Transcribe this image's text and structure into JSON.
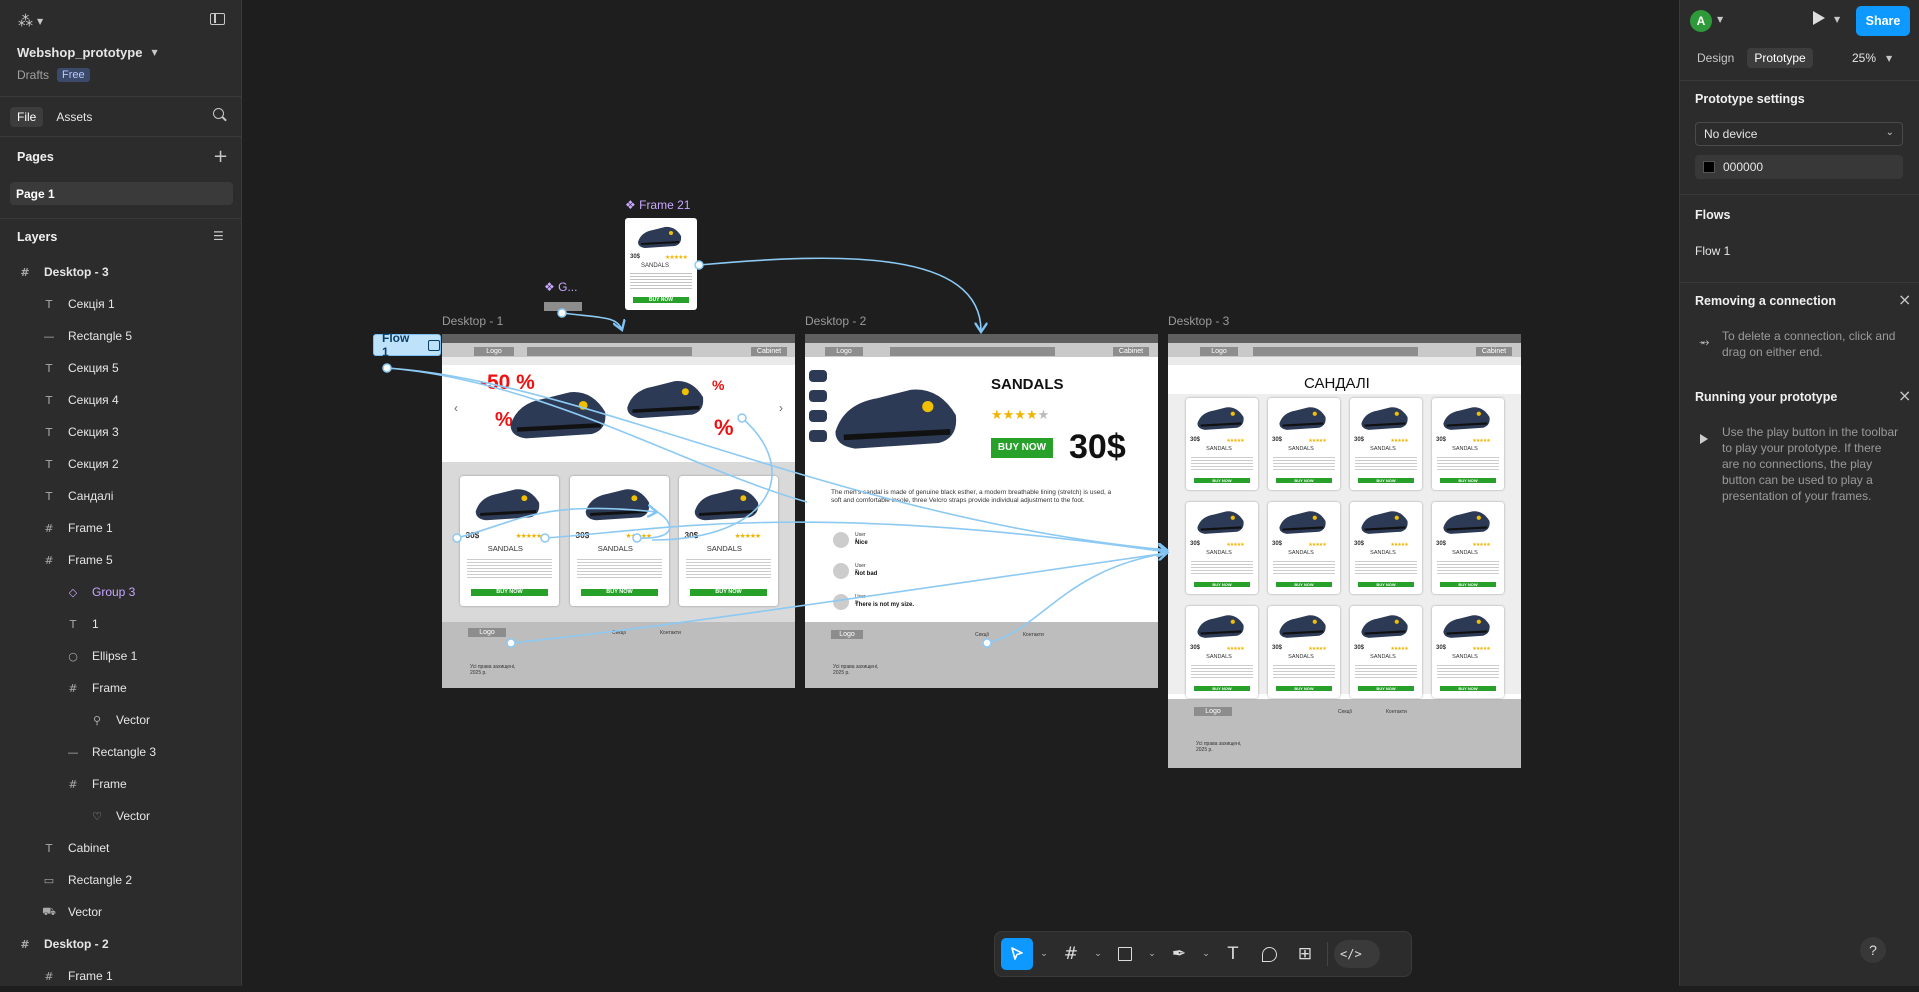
{
  "file": {
    "name": "Webshop_prototype",
    "location": "Drafts",
    "plan": "Free"
  },
  "left_tabs": {
    "file": "File",
    "assets": "Assets"
  },
  "pages": {
    "title": "Pages",
    "items": [
      "Page 1"
    ]
  },
  "layers": {
    "title": "Layers",
    "items": [
      {
        "icon": "frame-icon",
        "glyph": "#",
        "label": "Desktop - 3",
        "bold": true
      },
      {
        "icon": "text-icon",
        "glyph": "T",
        "label": "Секція 1"
      },
      {
        "icon": "rectangle-icon",
        "glyph": "—",
        "label": "Rectangle 5"
      },
      {
        "icon": "text-icon",
        "glyph": "T",
        "label": "Секция 5"
      },
      {
        "icon": "text-icon",
        "glyph": "T",
        "label": "Секция 4"
      },
      {
        "icon": "text-icon",
        "glyph": "T",
        "label": "Секция 3"
      },
      {
        "icon": "text-icon",
        "glyph": "T",
        "label": "Секция 2"
      },
      {
        "icon": "text-icon",
        "glyph": "T",
        "label": "Сандалі"
      },
      {
        "icon": "frame-icon",
        "glyph": "#",
        "label": "Frame 1"
      },
      {
        "icon": "frame-icon",
        "glyph": "#",
        "label": "Frame 5"
      },
      {
        "icon": "component-icon",
        "glyph": "◇",
        "label": "Group 3",
        "purple": true
      },
      {
        "icon": "text-icon",
        "glyph": "T",
        "label": "1"
      },
      {
        "icon": "ellipse-icon",
        "glyph": "○",
        "label": "Ellipse 1"
      },
      {
        "icon": "frame-icon",
        "glyph": "#",
        "label": "Frame"
      },
      {
        "icon": "vector-icon",
        "glyph": "⚲",
        "label": "Vector"
      },
      {
        "icon": "rectangle-icon",
        "glyph": "—",
        "label": "Rectangle 3"
      },
      {
        "icon": "frame-icon",
        "glyph": "#",
        "label": "Frame"
      },
      {
        "icon": "vector-icon",
        "glyph": "♡",
        "label": "Vector"
      },
      {
        "icon": "text-icon",
        "glyph": "T",
        "label": "Cabinet"
      },
      {
        "icon": "rectangle-icon",
        "glyph": "▭",
        "label": "Rectangle 2"
      },
      {
        "icon": "cart-icon",
        "glyph": "⛟",
        "label": "Vector"
      },
      {
        "icon": "frame-icon",
        "glyph": "#",
        "label": "Desktop - 2",
        "bold": true
      },
      {
        "icon": "frame-icon",
        "glyph": "#",
        "label": "Frame 1"
      }
    ]
  },
  "right": {
    "avatar": "A",
    "share": "Share",
    "tabs": [
      "Design",
      "Prototype"
    ],
    "zoom": "25%",
    "prototype_settings": "Prototype settings",
    "device": "No device",
    "bg_color": "000000",
    "flows_title": "Flows",
    "flow_item": "Flow 1",
    "removing_title": "Removing a connection",
    "removing_text": "To delete a connection, click and drag on either end.",
    "running_title": "Running your prototype",
    "running_text": "Use the play button in the toolbar to play your prototype. If there are no connections, the play button can be used to play a presentation of your frames."
  },
  "canvas": {
    "flow_label": "Flow 1",
    "frame21_label": "Frame 21",
    "group_label": "G...",
    "desktop1_label": "Desktop - 1",
    "desktop2_label": "Desktop - 2",
    "desktop3_label": "Desktop - 3",
    "logo": "Logo",
    "cabinet": "Cabinet",
    "sale": "-50 %",
    "percent": "%",
    "price": "30$",
    "sandals": "SANDALS",
    "sandals_ua": "САНДАЛІ",
    "buy_now": "BUY NOW",
    "buy_now_small": "BUY NOW",
    "desc": "The men's sandal is made of genuine black esther, a modern breathable lining (stretch) is used, a soft and comfortable insole, three Velcro straps provide individual adjustment to the foot.",
    "review1_user": "User 1",
    "review1_text": "Nice",
    "review2_user": "User 2",
    "review2_text": "Not bad",
    "review3_user": "User 3",
    "review3_text": "There is not my size.",
    "footer_rights": "Усі права захищені, 2025 р.",
    "footer_sections": "Секції",
    "footer_info": "Контакти"
  },
  "toolbar": {
    "items": [
      "move-tool",
      "frame-tool",
      "shape-tool",
      "pen-tool",
      "text-tool",
      "comment-tool",
      "actions-tool",
      "dev-mode-toggle"
    ]
  }
}
